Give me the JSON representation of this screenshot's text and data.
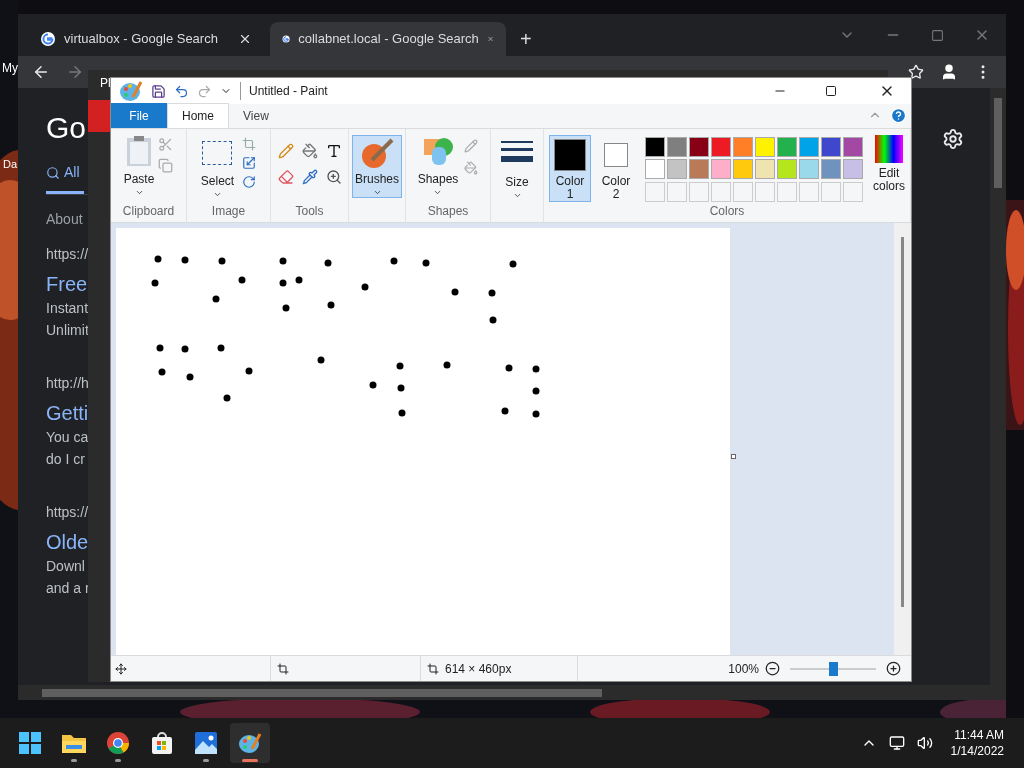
{
  "desktop": {
    "icon_labels": [
      "My",
      "Da"
    ]
  },
  "browser": {
    "tabs": [
      {
        "label": "virtualbox - Google Search",
        "selected": false
      },
      {
        "label": "collabnet.local - Google Search",
        "selected": true
      }
    ],
    "new_tab": "+",
    "page": {
      "logo": "Go",
      "search_tabs": [
        {
          "label": "All",
          "selected": true
        }
      ],
      "results_info": "About",
      "results": [
        {
          "url": "https://",
          "title": "Free",
          "snippet": [
            "Instant",
            "Unlimit"
          ]
        },
        {
          "url": "http://h",
          "title": "Getti",
          "snippet": [
            "You ca",
            "do I cr"
          ]
        },
        {
          "url": "https://",
          "title": "Olde",
          "snippet": [
            "Downl",
            "and a r"
          ]
        }
      ]
    }
  },
  "background_window": {
    "title": "Pl"
  },
  "paint": {
    "title": "Untitled - Paint",
    "tabs": [
      {
        "label": "File",
        "kind": "file",
        "selected": false
      },
      {
        "label": "Home",
        "kind": "tab",
        "selected": true
      },
      {
        "label": "View",
        "kind": "tab",
        "selected": false
      }
    ],
    "clipboard": {
      "label": "Clipboard",
      "paste": "Paste"
    },
    "image": {
      "label": "Image",
      "select": "Select"
    },
    "tools": {
      "label": "Tools"
    },
    "brushes": {
      "label": "Brushes",
      "selected": true
    },
    "shapes": {
      "label": "Shapes",
      "button": "Shapes"
    },
    "size": {
      "label": "Size"
    },
    "colors": {
      "label": "Colors",
      "color1": {
        "label": "Color",
        "number": "1",
        "color": "#000000",
        "selected": true
      },
      "color2": {
        "label": "Color",
        "number": "2",
        "color": "#ffffff",
        "selected": false
      },
      "palette": [
        {
          "color": "#000000"
        },
        {
          "color": "#7f7f7f"
        },
        {
          "color": "#880015"
        },
        {
          "color": "#ed1c24"
        },
        {
          "color": "#ff7f27"
        },
        {
          "color": "#fff200"
        },
        {
          "color": "#22b14c"
        },
        {
          "color": "#00a2e8"
        },
        {
          "color": "#3f48cc"
        },
        {
          "color": "#a349a4"
        },
        {
          "color": "#ffffff"
        },
        {
          "color": "#c3c3c3"
        },
        {
          "color": "#b97a57"
        },
        {
          "color": "#ffaec9"
        },
        {
          "color": "#ffc90e"
        },
        {
          "color": "#efe4b0"
        },
        {
          "color": "#b5e61d"
        },
        {
          "color": "#99d9ea"
        },
        {
          "color": "#7092be"
        },
        {
          "color": "#c8bfe7"
        }
      ],
      "edit": [
        "Edit",
        "colors"
      ]
    },
    "status": {
      "canvas_size": "614 × 460px",
      "zoom": "100%",
      "zoom_slider": {
        "level": 0.5
      }
    }
  },
  "taskbar": {
    "apps": [
      {
        "kind": "start",
        "selected": false,
        "running": false
      },
      {
        "kind": "explorer",
        "selected": false,
        "running": true
      },
      {
        "kind": "chrome",
        "selected": false,
        "running": true
      },
      {
        "kind": "store",
        "selected": false,
        "running": false
      },
      {
        "kind": "photos",
        "selected": false,
        "running": true
      },
      {
        "kind": "paint",
        "selected": true,
        "running": true
      }
    ],
    "time": "11:44 AM",
    "date": "1/14/2022"
  }
}
